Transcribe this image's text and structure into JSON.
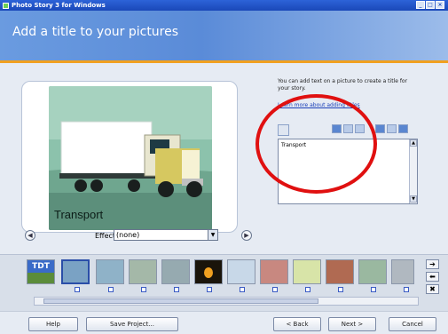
{
  "window": {
    "title": "Photo Story 3 for Windows",
    "controls": [
      "_",
      "□",
      "×"
    ]
  },
  "header": {
    "title": "Add a title to your pictures"
  },
  "preview": {
    "caption": "Transport",
    "prev_label": "◀",
    "next_label": "▶"
  },
  "effect": {
    "label": "Effect:",
    "value": "(none)"
  },
  "instructions": {
    "text": "You can add text on a picture to create a title for your story.",
    "link": "Learn more about adding titles"
  },
  "text_input": {
    "value": "Transport"
  },
  "filmstrip": {
    "first_thumb_label": "TDT"
  },
  "film_controls": {
    "right": "➔",
    "left": "⬅",
    "remove": "✖"
  },
  "footer": {
    "help": "Help",
    "save_project": "Save Project...",
    "back": "< Back",
    "next": "Next >",
    "cancel": "Cancel"
  },
  "colors": {
    "accent": "#f0a020",
    "header": "#5a8bd8",
    "highlight": "#e01010"
  }
}
